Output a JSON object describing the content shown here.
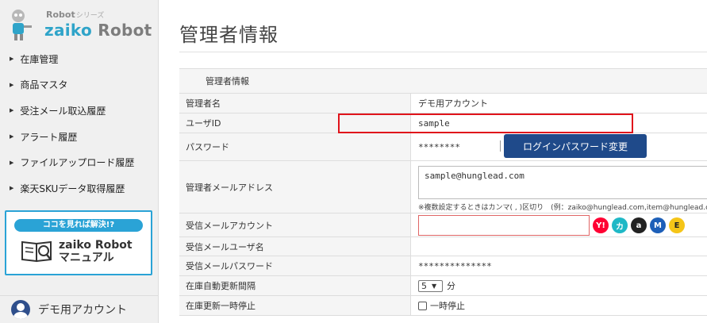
{
  "logo": {
    "small": "Robot",
    "series": "シリーズ",
    "brand_part1": "zaiko",
    "brand_part2": " Robot"
  },
  "sidebar": {
    "items": [
      {
        "label": "在庫管理"
      },
      {
        "label": "商品マスタ"
      },
      {
        "label": "受注メール取込履歴"
      },
      {
        "label": "アラート履歴"
      },
      {
        "label": "ファイルアップロード履歴"
      },
      {
        "label": "楽天SKUデータ取得履歴"
      }
    ],
    "manual": {
      "headline": "ココを見れば解決!?",
      "title_line1": "zaiko Robot",
      "title_line2": "マニュアル"
    },
    "account_name": "デモ用アカウント"
  },
  "main": {
    "page_title": "管理者情報",
    "section_header": "管理者情報",
    "rows": {
      "admin_name": {
        "label": "管理者名",
        "value": "デモ用アカウント"
      },
      "user_id": {
        "label": "ユーザID",
        "value": "sample"
      },
      "password": {
        "label": "パスワード",
        "value": "********",
        "button": "ログインパスワード変更"
      },
      "admin_email": {
        "label": "管理者メールアドレス",
        "value": "sample@hunglead.com",
        "note": "※複数設定するときはカンマ( , )区切り　(例：zaiko@hunglead.com,item@hunglead.com)"
      },
      "recv_account": {
        "label": "受信メールアカウント",
        "value": ""
      },
      "recv_user": {
        "label": "受信メールユーザ名",
        "value": ""
      },
      "recv_password": {
        "label": "受信メールパスワード",
        "value": "**************"
      },
      "auto_update": {
        "label": "在庫自動更新間隔",
        "value": "5",
        "unit": "分"
      },
      "pause": {
        "label": "在庫更新一時停止",
        "checkbox_label": "一時停止"
      }
    },
    "services": [
      {
        "name": "yahoo",
        "glyph": "Y!",
        "color": "#ff0033"
      },
      {
        "name": "kakaku",
        "glyph": "カ",
        "color": "#1fb8c6"
      },
      {
        "name": "amazon",
        "glyph": "a",
        "color": "#222222"
      },
      {
        "name": "makeshop",
        "glyph": "M",
        "color": "#1d5fb8"
      },
      {
        "name": "ebay-e",
        "glyph": "E",
        "color": "#f5c518"
      }
    ]
  },
  "colors": {
    "accent_blue": "#1f4a8a",
    "highlight_red": "#e0131b",
    "brand_cyan": "#2fa4c9"
  }
}
